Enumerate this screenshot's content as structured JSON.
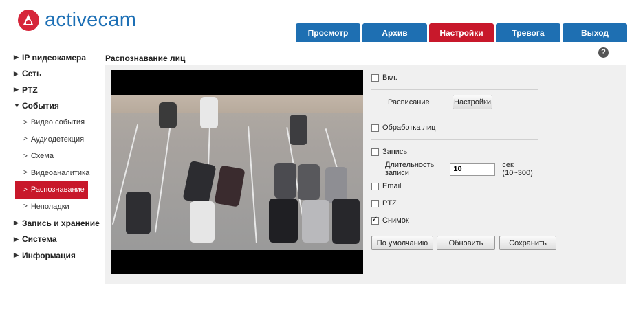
{
  "brand": {
    "name": "activecam"
  },
  "topnav": {
    "tabs": [
      {
        "label": "Просмотр",
        "active": false
      },
      {
        "label": "Архив",
        "active": false
      },
      {
        "label": "Настройки",
        "active": true
      },
      {
        "label": "Тревога",
        "active": false
      },
      {
        "label": "Выход",
        "active": false
      }
    ]
  },
  "sidebar": {
    "sections": [
      {
        "label": "IP видеокамера",
        "expanded": false
      },
      {
        "label": "Сеть",
        "expanded": false
      },
      {
        "label": "PTZ",
        "expanded": false
      },
      {
        "label": "События",
        "expanded": true
      },
      {
        "label": "Запись и хранение",
        "expanded": false
      },
      {
        "label": "Система",
        "expanded": false
      },
      {
        "label": "Информация",
        "expanded": false
      }
    ],
    "events_items": [
      {
        "label": "Видео события",
        "active": false
      },
      {
        "label": "Аудиодетекция",
        "active": false
      },
      {
        "label": "Схема",
        "active": false
      },
      {
        "label": "Видеоаналитика",
        "active": false
      },
      {
        "label": "Распознавание",
        "active": true
      },
      {
        "label": "Неполадки",
        "active": false
      }
    ]
  },
  "page": {
    "title": "Распознавание лиц",
    "help": "?"
  },
  "settings": {
    "enable": {
      "label": "Вкл.",
      "checked": false
    },
    "schedule": {
      "label": "Расписание",
      "button": "Настройки"
    },
    "face_processing": {
      "label": "Обработка лиц",
      "checked": false
    },
    "record": {
      "label": "Запись",
      "checked": false
    },
    "duration": {
      "label": "Длительность записи",
      "value": "10",
      "unit": "сек (10~300)"
    },
    "email": {
      "label": "Email",
      "checked": false
    },
    "ptz": {
      "label": "PTZ",
      "checked": false
    },
    "snapshot": {
      "label": "Снимок",
      "checked": true
    }
  },
  "actions": {
    "default": "По умолчанию",
    "refresh": "Обновить",
    "save": "Сохранить"
  },
  "colors": {
    "brand_blue": "#1e6fb2",
    "brand_red": "#c8182b",
    "logo_red": "#d6263a"
  },
  "icons": {
    "logo": "activecam-logo-icon",
    "help": "help-icon",
    "expand": "triangle-right-icon",
    "collapse": "triangle-down-icon",
    "sub": "chevron-right-icon"
  }
}
